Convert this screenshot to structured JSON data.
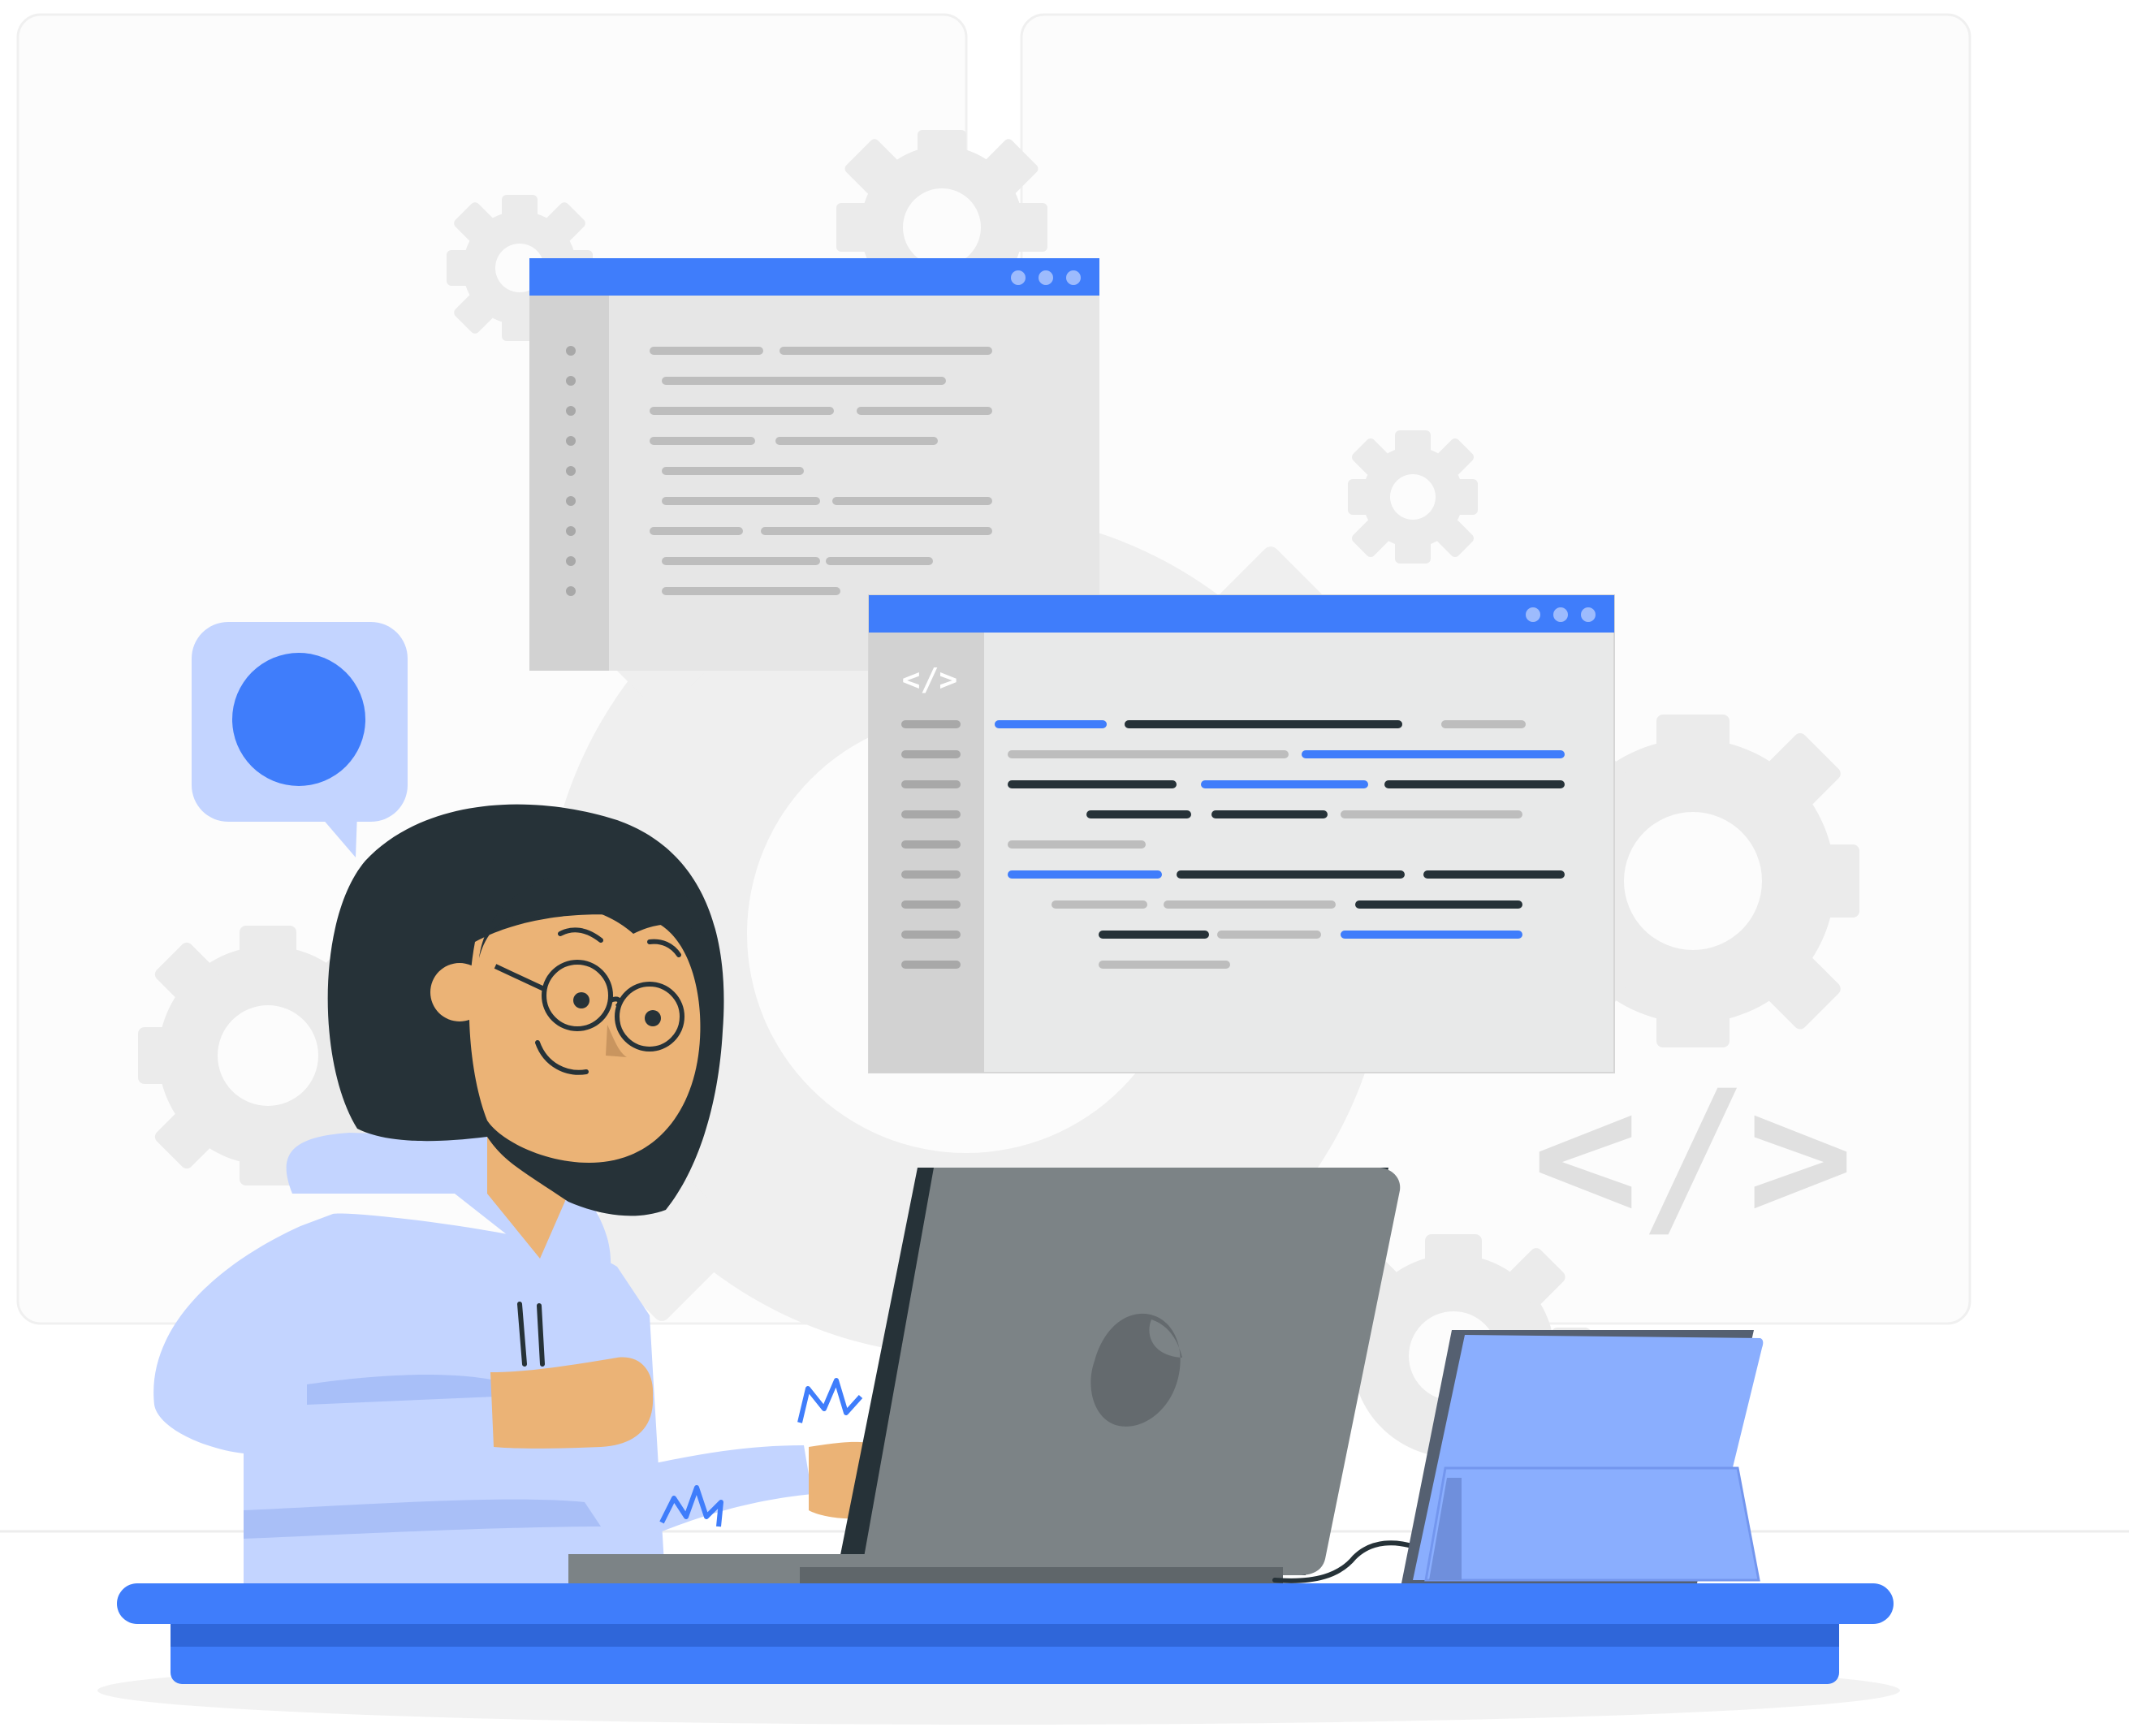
{
  "illustration": {
    "subject": "developer-at-desk",
    "colors": {
      "primary_blue": "#3F7DFB",
      "dark_blue": "#2F66D9",
      "light_blue": "#C3D4FF",
      "tablet_blue": "#8AAEFE",
      "hair": "#263238",
      "skin": "#EBB376",
      "laptop_gray": "#7C8386",
      "panel_gray": "#E8E9E9",
      "gear_gray": "#EBEBEB",
      "code_line_gray": "#BDBDBD",
      "code_line_dark": "#263238"
    },
    "icons": [
      "gear-icon",
      "speech-bubble-icon",
      "code-tag-icon",
      "apple-logo-icon",
      "browser-dots-icon"
    ],
    "code_tag_small": "</>",
    "code_tag_large": "</>"
  }
}
